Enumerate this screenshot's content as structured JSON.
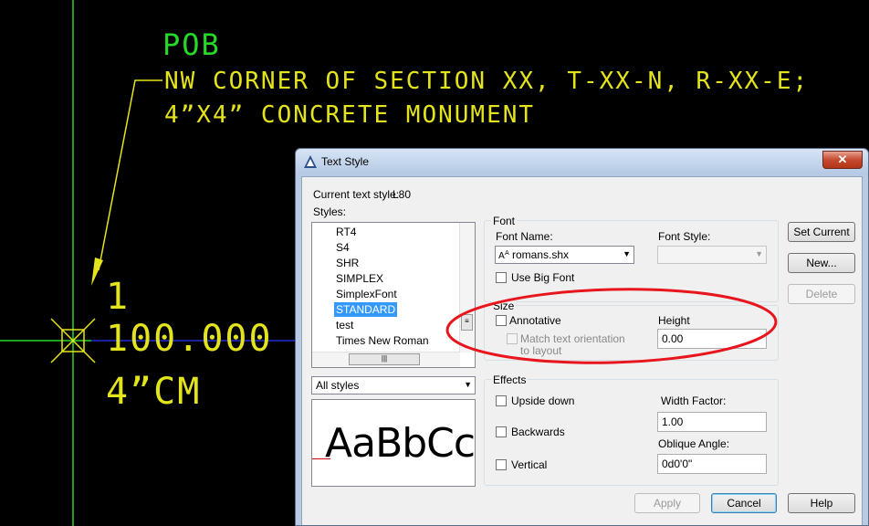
{
  "cad": {
    "pob": "POB",
    "line1": "NW CORNER OF SECTION XX, T-XX-N, R-XX-E;",
    "line2": "4”X4” CONCRETE MONUMENT",
    "point_number": "1",
    "elevation": "100.000",
    "description": "4”CM",
    "colors": {
      "background": "#000000",
      "green": "#27d927",
      "yellow": "#e4e41c",
      "blue": "#1f2fd8",
      "red_annotation": "#e8151d"
    }
  },
  "dialog": {
    "title": "Text Style",
    "close_glyph": "✕",
    "current_style_label": "Current text style:",
    "current_style_value": "L80",
    "styles_label": "Styles:",
    "styles": [
      "RT4",
      "S4",
      "SHR",
      "SIMPLEX",
      "SimplexFont",
      "STANDARD",
      "test",
      "Times New Roman"
    ],
    "selected_style": "STANDARD",
    "filter_value": "All styles",
    "preview_text": "AaBbCc",
    "font": {
      "legend": "Font",
      "font_name_label": "Font Name:",
      "font_name_value": "romans.shx",
      "font_style_label": "Font Style:",
      "font_style_value": "",
      "big_font_label": "Use Big Font"
    },
    "size": {
      "legend": "Size",
      "annotative_label": "Annotative",
      "match_orientation_line1": "Match text orientation",
      "match_orientation_line2": "to layout",
      "height_label": "Height",
      "height_value": "0.00"
    },
    "effects": {
      "legend": "Effects",
      "upside_down_label": "Upside down",
      "backwards_label": "Backwards",
      "vertical_label": "Vertical",
      "width_factor_label": "Width Factor:",
      "width_factor_value": "1.00",
      "oblique_angle_label": "Oblique Angle:",
      "oblique_angle_value": "0d0'0\""
    },
    "buttons": {
      "set_current": "Set Current",
      "new": "New...",
      "delete": "Delete",
      "apply": "Apply",
      "cancel": "Cancel",
      "help": "Help"
    }
  }
}
